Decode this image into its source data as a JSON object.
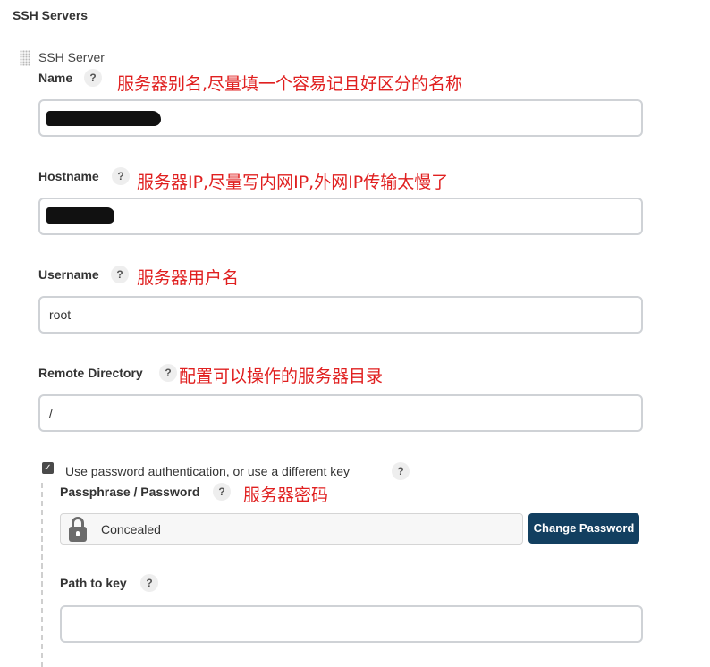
{
  "section": {
    "title": "SSH Servers"
  },
  "server": {
    "title": "SSH Server",
    "name": {
      "label": "Name",
      "help": "?",
      "note": "服务器别名,尽量填一个容易记且好区分的名称",
      "value": ""
    },
    "hostname": {
      "label": "Hostname",
      "help": "?",
      "note": "服务器IP,尽量写内网IP,外网IP传输太慢了",
      "value": ""
    },
    "username": {
      "label": "Username",
      "help": "?",
      "note": "服务器用户名",
      "value": "root"
    },
    "remote_directory": {
      "label": "Remote Directory",
      "help": "?",
      "note": "配置可以操作的服务器目录",
      "value": "/"
    },
    "password_auth": {
      "checked": true,
      "label": "Use password authentication, or use a different key",
      "help": "?",
      "passphrase": {
        "label": "Passphrase / Password",
        "help": "?",
        "note": "服务器密码",
        "value": "Concealed",
        "button": "Change Password"
      },
      "path_to_key": {
        "label": "Path to key",
        "help": "?",
        "value": ""
      }
    }
  },
  "colors": {
    "note": "#e02020",
    "button": "#123f60",
    "border": "#cfd2d6"
  },
  "icons": {
    "drag": "drag-handle-icon",
    "lock": "lock-icon",
    "check": "checkbox-checked-icon"
  }
}
